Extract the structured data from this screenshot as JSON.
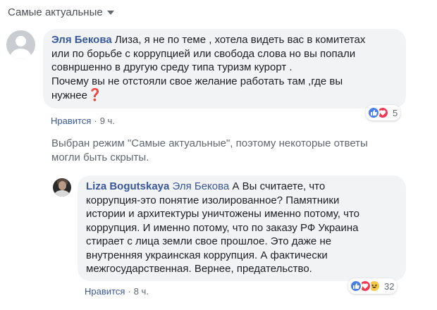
{
  "sort": {
    "label": "Самые актуальные"
  },
  "comment1": {
    "author": "Эля Бекова",
    "text_lines": [
      "Лиза, я не по теме , хотела видеть вас в комитетах",
      "или по борьбе с коррупцией или свобода слова но вы попали",
      "совнршенно в другую среду типа туризм курорт .",
      "Почему вы не отстояли свое желание работать там ,где вы",
      "нужнее"
    ],
    "end_mark": "❓",
    "like_label": "Нравится",
    "separator": "·",
    "time": "9 ч.",
    "reactions": [
      "like",
      "love"
    ],
    "reaction_count": "5"
  },
  "notice": {
    "line1": "Выбран режим \"Самые актуальные\", поэтому некоторые ответы",
    "line2": "могли быть скрыты."
  },
  "reply1": {
    "author": "Liza Bogutskaya",
    "mention": "Эля Бекова",
    "text_lines": [
      "А Вы считаете, что",
      "коррупция-это понятие изолированное? Памятники",
      "истории и архитектуры уничтожены именно потому, что",
      "коррупция. И именно потому, что по заказу РФ Украина",
      "стирает с лица земли свое прошлое. Это даже не",
      "внутренняя украинская коррупция. А фактически",
      "межгосударственная. Вернее, предательство."
    ],
    "like_label": "Нравится",
    "separator": "·",
    "time": "8 ч.",
    "reactions": [
      "like",
      "love",
      "haha"
    ],
    "reaction_count": "32"
  },
  "colors": {
    "link": "#385898",
    "bubble": "#f2f3f5",
    "meta": "#606770",
    "like": "#4a7fe7",
    "love": "#f03a55",
    "haha": "#f7c94a"
  }
}
